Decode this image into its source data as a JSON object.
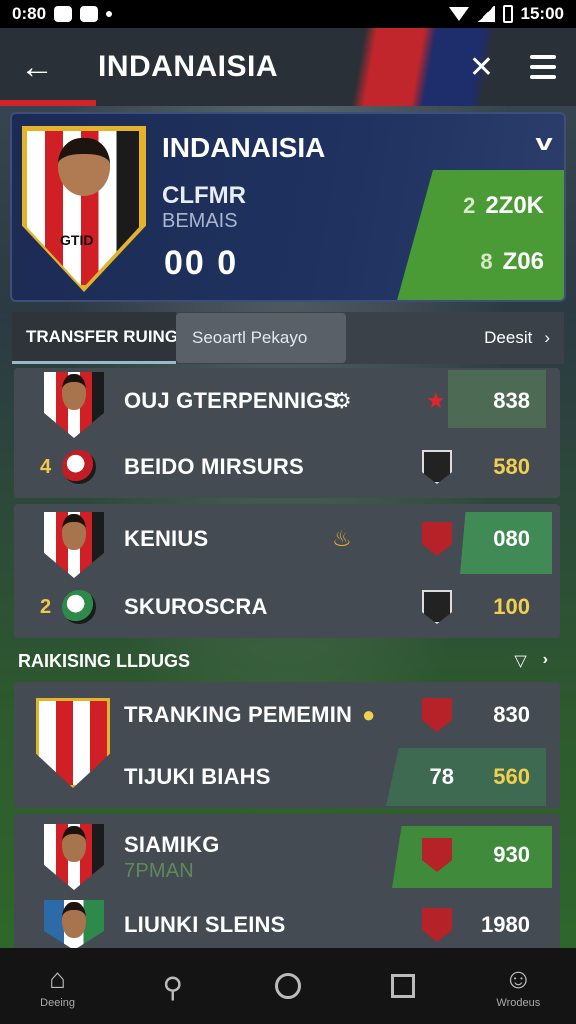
{
  "status_bar": {
    "time_left": "0:80",
    "time_right": "15:00"
  },
  "app_bar": {
    "title": "INDANAISIA"
  },
  "profile": {
    "name": "INDANAISIA",
    "club": "CLFMR",
    "sub": "BEMAIS",
    "score": "00  0",
    "crest_text": "GTID",
    "stat1": "2Z0K",
    "stat2": "Z06",
    "stat1_icon": "2",
    "stat2_icon": "8"
  },
  "tabs": {
    "active": "TRANSFER RUINGS",
    "search_placeholder": "Seoartl Pekayo",
    "right_label": "Deesit"
  },
  "group1": [
    {
      "name": "OUJ GTERPENNIGS",
      "value": "838"
    },
    {
      "rank": "4",
      "name": "BEIDO MIRSURS",
      "value": "580"
    }
  ],
  "group2": [
    {
      "name": "KENIUS",
      "value": "080"
    },
    {
      "rank": "2",
      "name": "SKUROSCRA",
      "value": "100"
    }
  ],
  "section": {
    "title": "RAIKISING LLDUGS"
  },
  "group3": [
    {
      "name": "TRANKING PEMEMIN",
      "value": "830"
    },
    {
      "name": "TIJUKI BIAHS",
      "value_left": "78",
      "value": "560"
    }
  ],
  "group4": [
    {
      "name": "SIAMIKG",
      "sub": "7PMAN",
      "value": "930"
    },
    {
      "name": "LIUNKI SLEINS",
      "value": "1980"
    }
  ],
  "bottom_nav": [
    {
      "label": "Deeing",
      "icon": "home-icon"
    },
    {
      "label": "",
      "icon": "search-icon"
    },
    {
      "label": "",
      "icon": "circle-icon"
    },
    {
      "label": "",
      "icon": "square-icon"
    },
    {
      "label": "Wrodeus",
      "icon": "profile-icon"
    }
  ],
  "colors": {
    "accent_red": "#d01f25",
    "navy": "#1c2b54",
    "green": "#4a9b35",
    "gold": "#f2d04f"
  }
}
